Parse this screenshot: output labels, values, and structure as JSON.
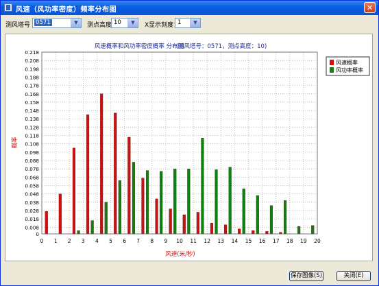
{
  "window": {
    "title": "风速（风功率密度）频率分布图",
    "close_glyph": "✕"
  },
  "toolbar": {
    "tower_label": "测风塔号",
    "tower_value": "0571",
    "height_label": "测点高度",
    "height_value": "10",
    "xscale_label": "X显示刻度：",
    "xscale_value": "1"
  },
  "buttons": {
    "save": "保存图像(S)",
    "close": "关闭(E)"
  },
  "chart_data": {
    "type": "bar",
    "title": "风速概率和风功率密度概率 分布图",
    "subtitle": "(测风塔号：0571，测点高度：10)",
    "xlabel": "风速(米/秒)",
    "ylabel": "概率",
    "xlim": [
      0,
      20
    ],
    "ylim": [
      0,
      0.218
    ],
    "y_ticks": [
      0,
      0.008,
      0.018,
      0.028,
      0.038,
      0.048,
      0.058,
      0.068,
      0.078,
      0.088,
      0.098,
      0.108,
      0.118,
      0.128,
      0.138,
      0.148,
      0.158,
      0.168,
      0.178,
      0.188,
      0.198,
      0.208,
      0.218
    ],
    "y_tick_labels": [
      "0",
      "0.008",
      "0.018",
      "0.028",
      "0.038",
      "0.048",
      "0.058",
      "0.068",
      "0.078",
      "0.088",
      "0.098",
      "0.108",
      "0.118",
      "0.128",
      "0.138",
      "0.148",
      "0.158",
      "0.168",
      "0.178",
      "0.188",
      "0.198",
      "0.208",
      "0.218"
    ],
    "x_ticks": [
      "0",
      "1",
      "2",
      "3",
      "4",
      "5",
      "6",
      "7",
      "8",
      "9",
      "10",
      "11",
      "12",
      "13",
      "14",
      "15",
      "16",
      "17",
      "18",
      "19",
      "20"
    ],
    "grid": true,
    "legend_position": "top-right",
    "x": [
      0.5,
      1.5,
      2.5,
      3.5,
      4.5,
      5.5,
      6.5,
      7.5,
      8.5,
      9.5,
      10.5,
      11.5,
      12.5,
      13.5,
      14.5,
      15.5,
      16.5,
      17.5,
      18.5,
      19.5
    ],
    "series": [
      {
        "name": "风速概率",
        "color": "#d01010",
        "values": [
          0.027,
          0.048,
          0.103,
          0.143,
          0.168,
          0.145,
          0.116,
          0.067,
          0.042,
          0.03,
          0.023,
          0.026,
          0.013,
          0.011,
          0.006,
          0.004,
          0.003,
          0.002,
          0.0,
          0.0
        ]
      },
      {
        "name": "风功率概率",
        "color": "#108010",
        "values": [
          0.0,
          0.0,
          0.004,
          0.016,
          0.038,
          0.064,
          0.086,
          0.076,
          0.075,
          0.078,
          0.078,
          0.115,
          0.077,
          0.08,
          0.054,
          0.046,
          0.034,
          0.04,
          0.009,
          0.01
        ]
      }
    ]
  }
}
